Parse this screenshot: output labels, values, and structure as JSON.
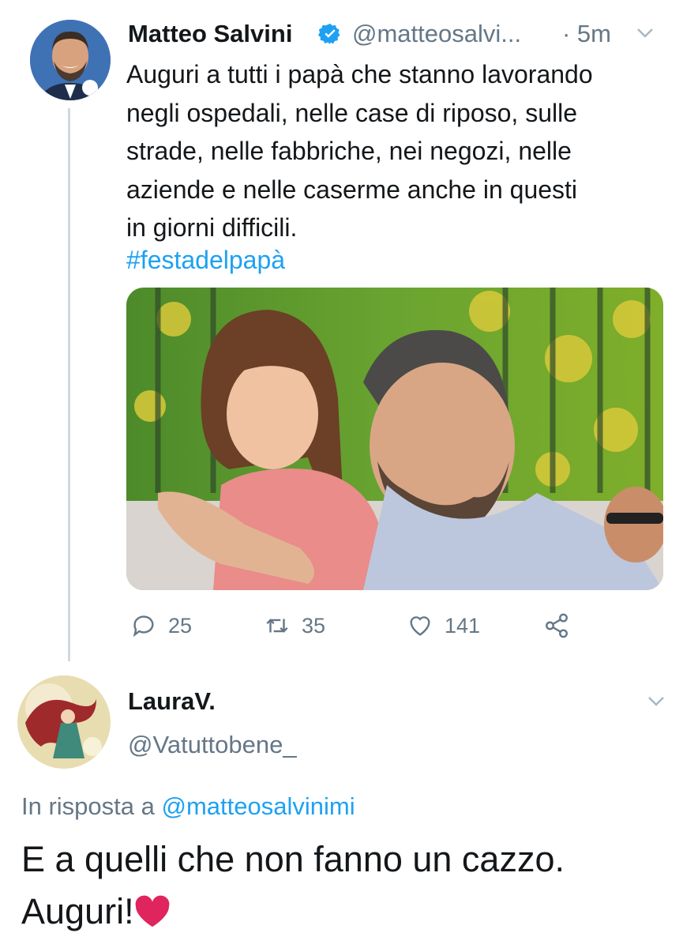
{
  "tweet": {
    "author_name": "Matteo Salvini",
    "author_handle": "@matteosalvi...",
    "time": "· 5m",
    "text": "Auguri a tutti i papà che stanno lavorando\nnegli ospedali, nelle case di riposo, sulle\nstrade, nelle fabbriche, nei negozi, nelle\naziende e nelle caserme anche in questi\nin giorni difficili.",
    "hashtag": "#festadelpapà",
    "actions": {
      "reply_count": "25",
      "retweet_count": "35",
      "like_count": "141"
    }
  },
  "reply": {
    "author_name": "LauraV.",
    "author_handle": "@Vatuttobene_",
    "in_reply_prefix": "In risposta a ",
    "in_reply_handle": "@matteosalvinimi",
    "text_line1": "E a quelli che non fanno un cazzo.",
    "text_line2": "Auguri!"
  },
  "colors": {
    "link": "#1da1f2",
    "muted": "#657786",
    "heart": "#e0245e"
  },
  "icons": [
    "verified-badge-icon",
    "chevron-down-icon",
    "reply-icon",
    "retweet-icon",
    "like-icon",
    "share-icon",
    "red-heart-emoji"
  ]
}
